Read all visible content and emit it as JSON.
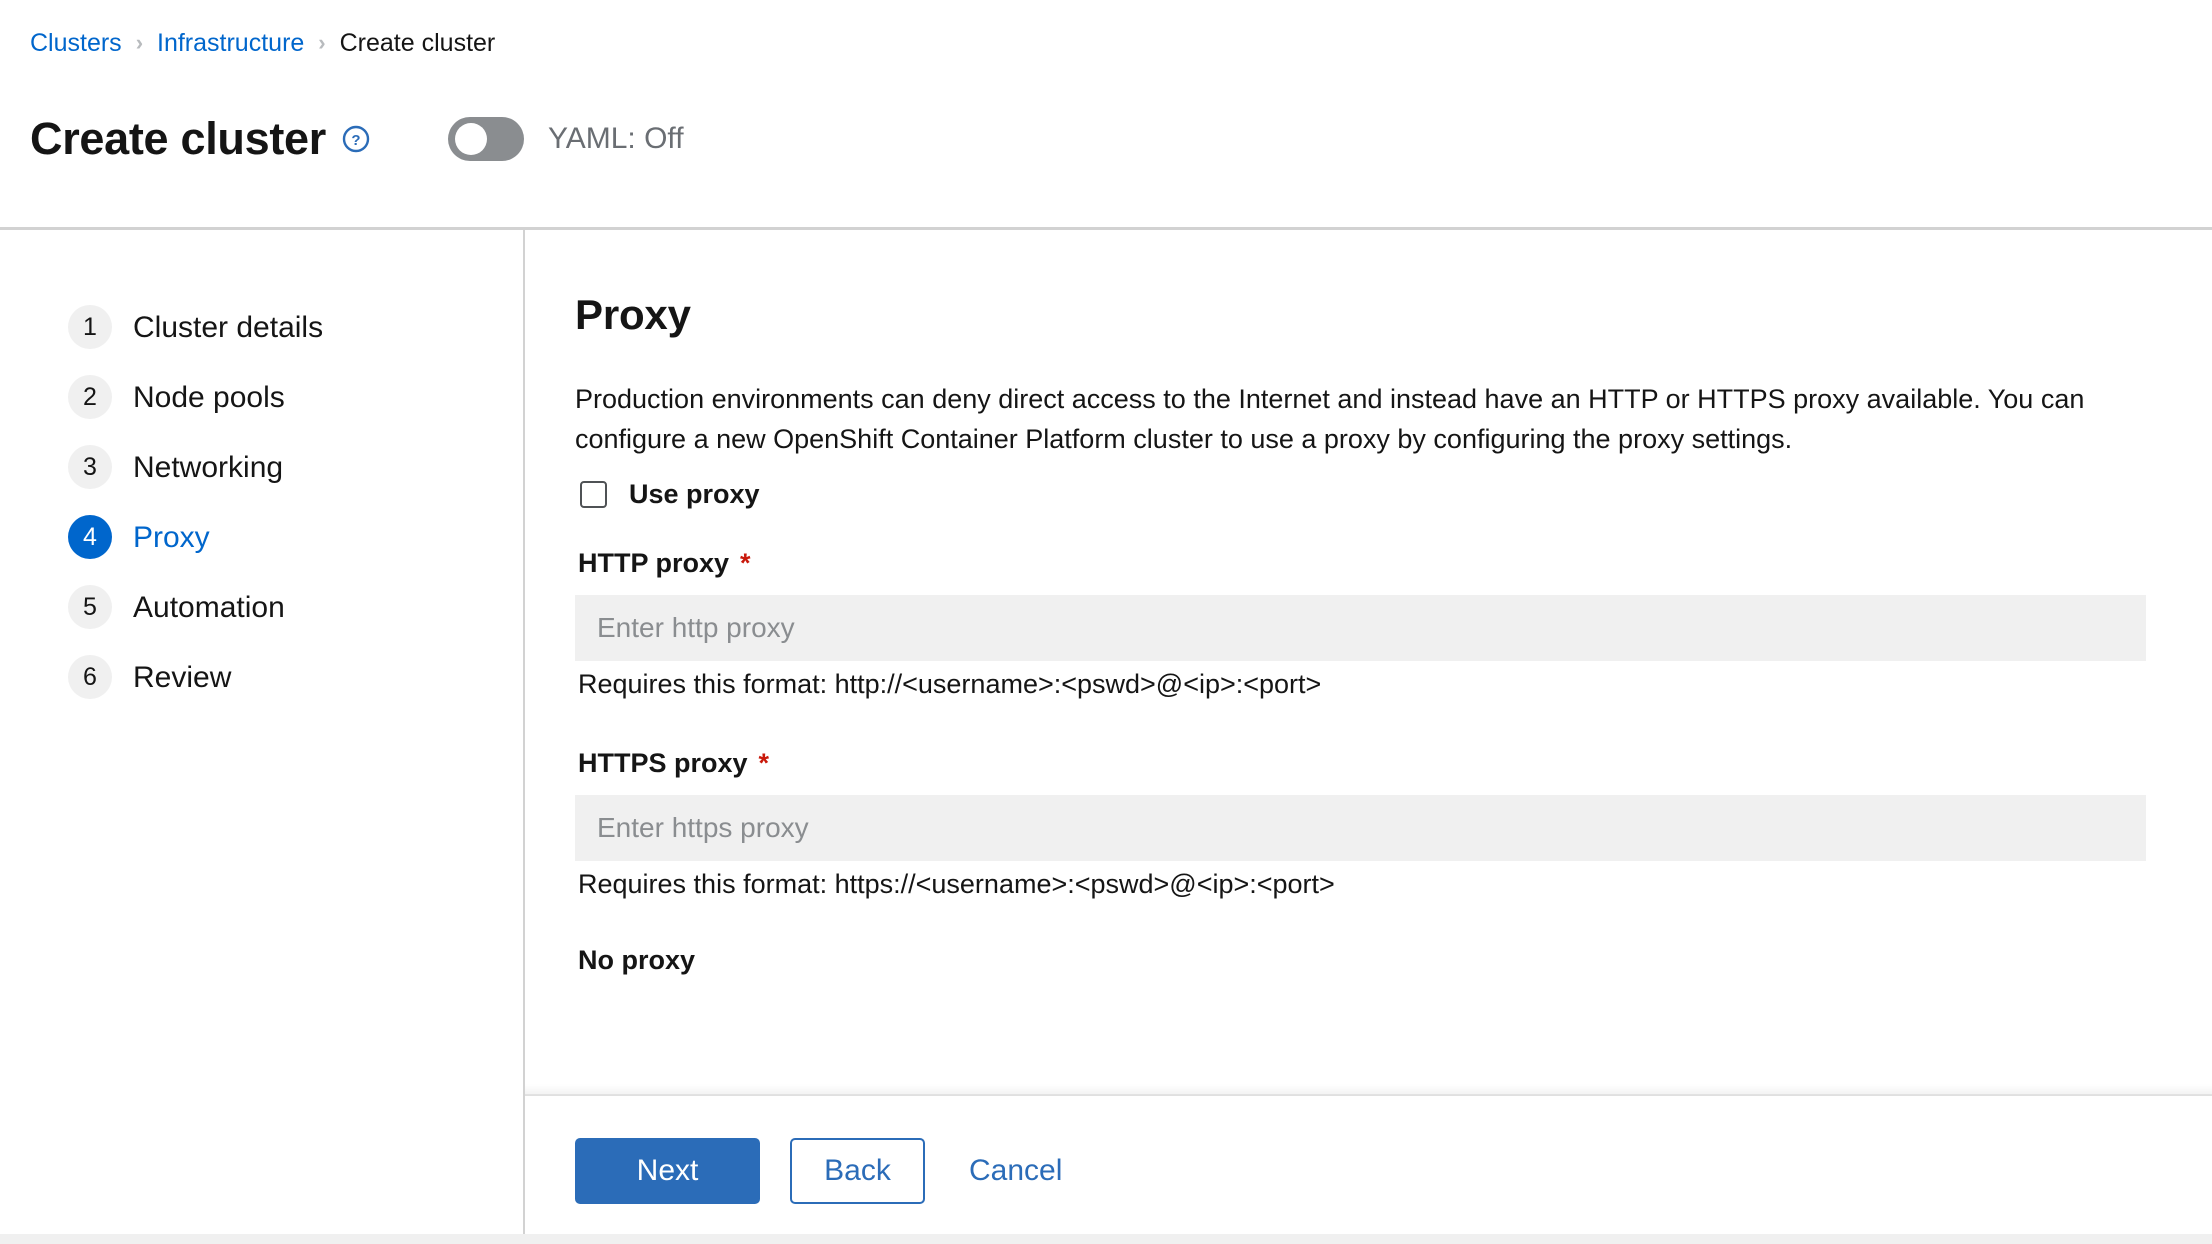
{
  "breadcrumb": {
    "items": [
      {
        "label": "Clusters",
        "type": "link"
      },
      {
        "label": "Infrastructure",
        "type": "link"
      },
      {
        "label": "Create cluster",
        "type": "current"
      }
    ],
    "separator": "›"
  },
  "header": {
    "title": "Create cluster",
    "help_icon": "help-circle-icon",
    "yaml_toggle": {
      "label": "YAML: Off",
      "state": "off"
    }
  },
  "wizard": {
    "steps": [
      {
        "num": "1",
        "label": "Cluster details",
        "active": false
      },
      {
        "num": "2",
        "label": "Node pools",
        "active": false
      },
      {
        "num": "3",
        "label": "Networking",
        "active": false
      },
      {
        "num": "4",
        "label": "Proxy",
        "active": true
      },
      {
        "num": "5",
        "label": "Automation",
        "active": false
      },
      {
        "num": "6",
        "label": "Review",
        "active": false
      }
    ]
  },
  "main": {
    "title": "Proxy",
    "description": "Production environments can deny direct access to the Internet and instead have an HTTP or HTTPS proxy available. You can configure a new OpenShift Container Platform cluster to use a proxy by configuring the proxy settings.",
    "use_proxy": {
      "label": "Use proxy",
      "checked": false
    },
    "http_proxy": {
      "label": "HTTP proxy",
      "required_marker": "*",
      "value": "",
      "placeholder": "Enter http proxy",
      "helper": "Requires this format: http://<username>:<pswd>@<ip>:<port>"
    },
    "https_proxy": {
      "label": "HTTPS proxy",
      "required_marker": "*",
      "value": "",
      "placeholder": "Enter https proxy",
      "helper": "Requires this format: https://<username>:<pswd>@<ip>:<port>"
    },
    "no_proxy": {
      "label": "No proxy"
    }
  },
  "footer": {
    "next_label": "Next",
    "back_label": "Back",
    "cancel_label": "Cancel"
  },
  "colors": {
    "link": "#0066cc",
    "primary_button": "#2b6cb8",
    "active_step": "#0066cc",
    "required": "#c9190b",
    "input_bg": "#f0f0f0",
    "toggle_off": "#8a8d90"
  }
}
